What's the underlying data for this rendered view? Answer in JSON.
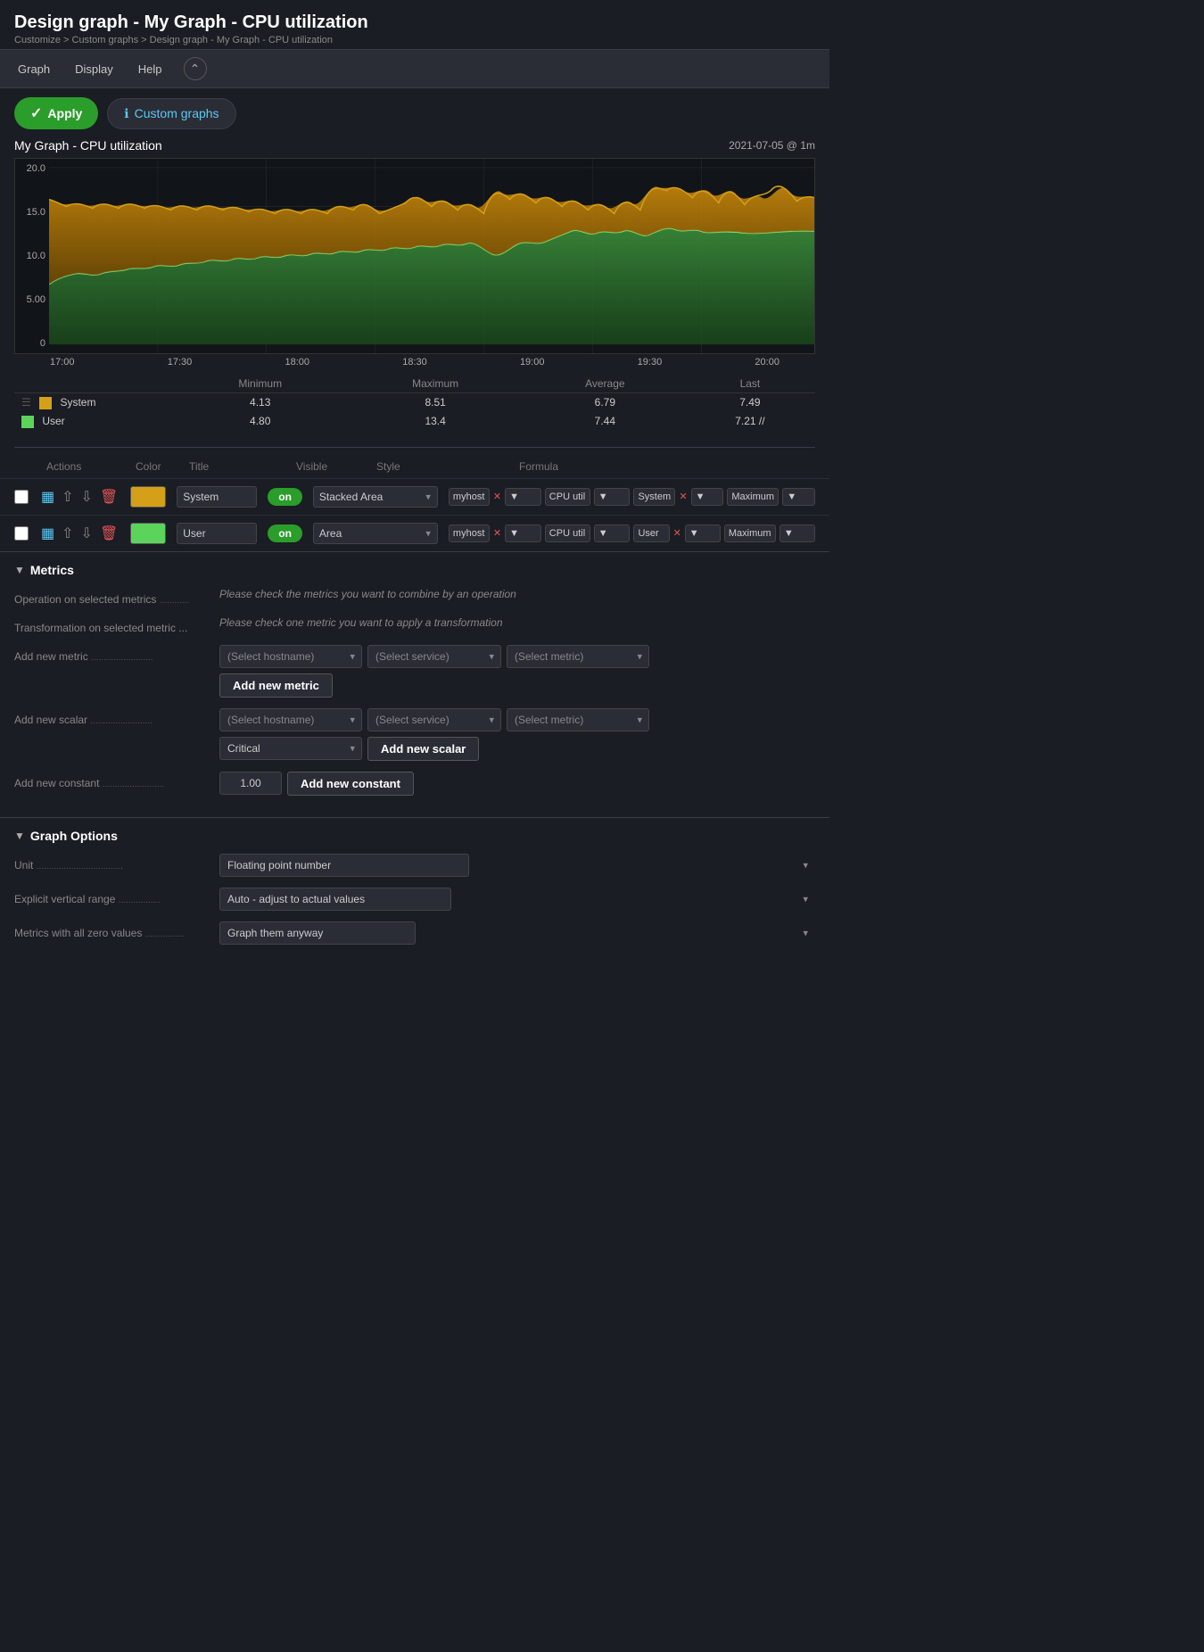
{
  "page": {
    "title": "Design graph - My Graph - CPU utilization",
    "breadcrumb": "Customize > Custom graphs > Design graph - My Graph - CPU utilization"
  },
  "menubar": {
    "items": [
      "Graph",
      "Display",
      "Help"
    ]
  },
  "toolbar": {
    "apply_label": "Apply",
    "custom_graphs_label": "Custom graphs"
  },
  "graph": {
    "title": "My Graph - CPU utilization",
    "timestamp": "2021-07-05 @ 1m",
    "y_axis": [
      "20.0",
      "15.0",
      "10.0",
      "5.00",
      "0"
    ],
    "x_axis": [
      "17:00",
      "17:30",
      "18:00",
      "18:30",
      "19:00",
      "19:30",
      "20:00"
    ],
    "legend": {
      "headers": [
        "",
        "Minimum",
        "Maximum",
        "Average",
        "Last"
      ],
      "rows": [
        {
          "color": "#d4a017",
          "name": "System",
          "min": "4.13",
          "max": "8.51",
          "avg": "6.79",
          "last": "7.49"
        },
        {
          "color": "#5cd45c",
          "name": "User",
          "min": "4.80",
          "max": "13.4",
          "avg": "7.44",
          "last": "7.21"
        }
      ]
    }
  },
  "metrics_header": {
    "actions": "Actions",
    "color": "Color",
    "title": "Title",
    "visible": "Visible",
    "style": "Style",
    "formula": "Formula"
  },
  "metric_rows": [
    {
      "id": "system",
      "color": "#d4a017",
      "title": "System",
      "visible": "on",
      "style": "Stacked Area",
      "formula_rows": [
        {
          "host": "myhost",
          "metric": "CPU util"
        },
        {
          "host": "System",
          "metric": "Maximum"
        }
      ]
    },
    {
      "id": "user",
      "color": "#5cd45c",
      "title": "User",
      "visible": "on",
      "style": "Area",
      "formula_rows": [
        {
          "host": "myhost",
          "metric": "CPU util"
        },
        {
          "host": "User",
          "metric": "Maximum"
        }
      ]
    }
  ],
  "metrics_section": {
    "header": "Metrics",
    "operation_label": "Operation on selected metrics",
    "operation_hint": "Please check the metrics you want to combine by an operation",
    "transformation_label": "Transformation on selected metric ...",
    "transformation_hint": "Please check one metric you want to apply a transformation",
    "add_metric_label": "Add new metric",
    "hostname_placeholder": "(Select hostname)",
    "service_placeholder": "(Select service)",
    "metric_placeholder": "(Select metric)",
    "add_metric_btn": "Add new metric",
    "add_scalar_label": "Add new scalar",
    "add_scalar_btn": "Add new scalar",
    "critical_option": "Critical",
    "add_constant_label": "Add new constant",
    "constant_value": "1.00",
    "add_constant_btn": "Add new constant"
  },
  "graph_options_section": {
    "header": "Graph Options",
    "unit_label": "Unit",
    "unit_value": "Floating point number",
    "range_label": "Explicit vertical range",
    "range_value": "Auto - adjust to actual values",
    "zero_label": "Metrics with all zero values",
    "zero_value": "Graph them anyway"
  }
}
